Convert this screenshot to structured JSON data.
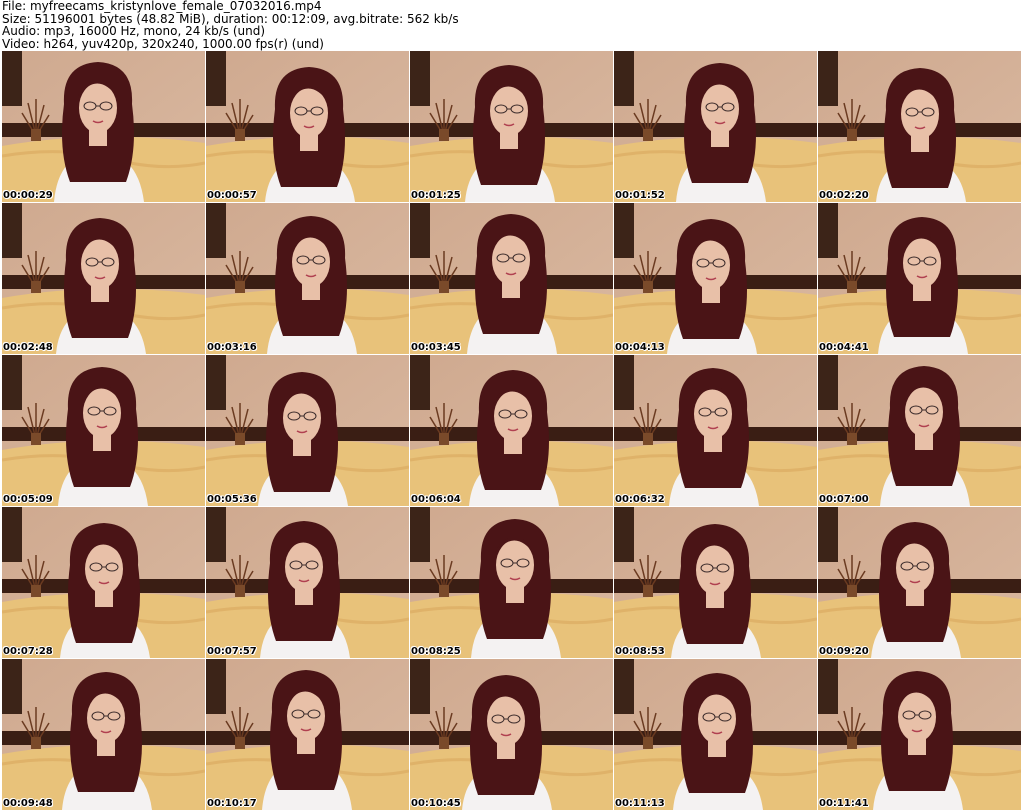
{
  "header": {
    "file_line": "File: myfreecams_kristynlove_female_07032016.mp4",
    "size_line": "Size: 51196001 bytes (48.82 MiB), duration: 00:12:09, avg.bitrate: 562 kb/s",
    "audio_line": "Audio: mp3, 16000 Hz, mono, 24 kb/s (und)",
    "video_line": "Video: h264, yuv420p, 320x240, 1000.00 fps(r) (und)"
  },
  "thumbnails": [
    {
      "timestamp": "00:00:29"
    },
    {
      "timestamp": "00:00:57"
    },
    {
      "timestamp": "00:01:25"
    },
    {
      "timestamp": "00:01:52"
    },
    {
      "timestamp": "00:02:20"
    },
    {
      "timestamp": "00:02:48"
    },
    {
      "timestamp": "00:03:16"
    },
    {
      "timestamp": "00:03:45"
    },
    {
      "timestamp": "00:04:13"
    },
    {
      "timestamp": "00:04:41"
    },
    {
      "timestamp": "00:05:09"
    },
    {
      "timestamp": "00:05:36"
    },
    {
      "timestamp": "00:06:04"
    },
    {
      "timestamp": "00:06:32"
    },
    {
      "timestamp": "00:07:00"
    },
    {
      "timestamp": "00:07:28"
    },
    {
      "timestamp": "00:07:57"
    },
    {
      "timestamp": "00:08:25"
    },
    {
      "timestamp": "00:08:53"
    },
    {
      "timestamp": "00:09:20"
    },
    {
      "timestamp": "00:09:48"
    },
    {
      "timestamp": "00:10:17"
    },
    {
      "timestamp": "00:10:45"
    },
    {
      "timestamp": "00:11:13"
    },
    {
      "timestamp": "00:11:41"
    }
  ],
  "colors": {
    "wall": "#d9b8a0",
    "bed": "#e8c27a",
    "headboard": "#3a1e14",
    "hair": "#4a1416",
    "skin": "#e8c0a8",
    "shirt": "#f4f2f2"
  }
}
